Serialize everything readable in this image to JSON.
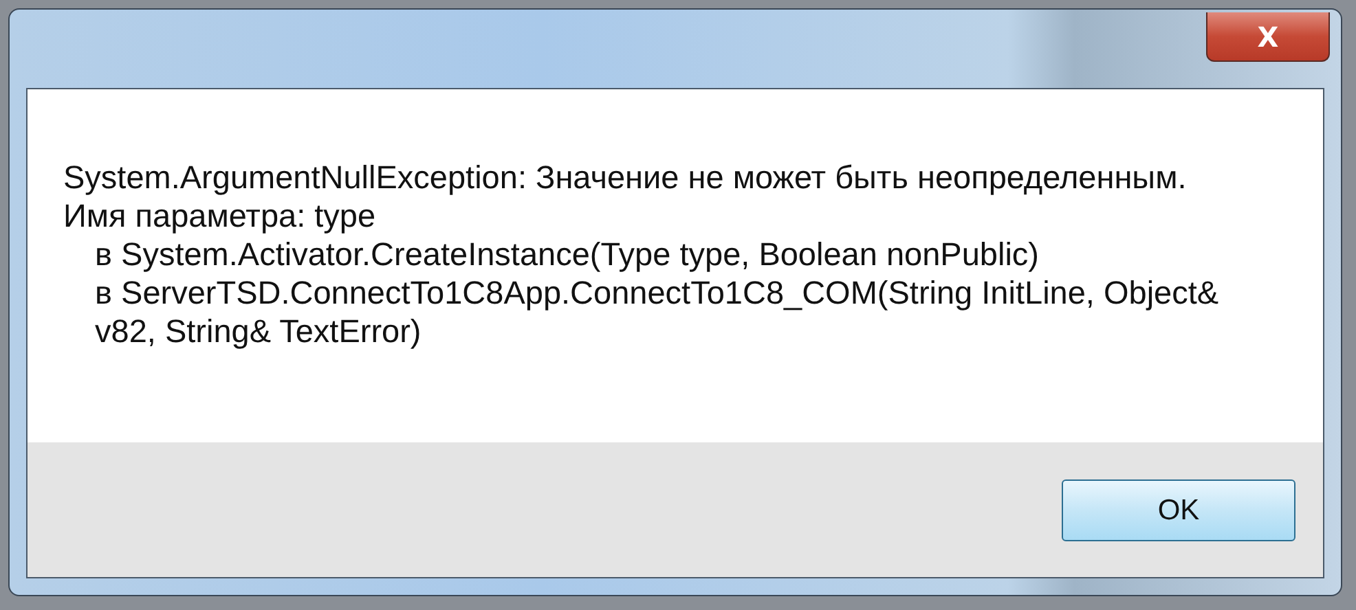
{
  "window": {
    "close_button": "X"
  },
  "message": {
    "lines": [
      {
        "text": "System.ArgumentNullException: Значение не может быть неопределенным.",
        "indented": false
      },
      {
        "text": "Имя параметра: type",
        "indented": false
      },
      {
        "text": "в System.Activator.CreateInstance(Type type, Boolean nonPublic)",
        "indented": true
      },
      {
        "text": "в ServerTSD.ConnectTo1C8App.ConnectTo1C8_COM(String InitLine, Object& v82, String& TextError)",
        "indented": true
      }
    ]
  },
  "buttons": [
    {
      "label": "OK",
      "selected": true
    }
  ]
}
